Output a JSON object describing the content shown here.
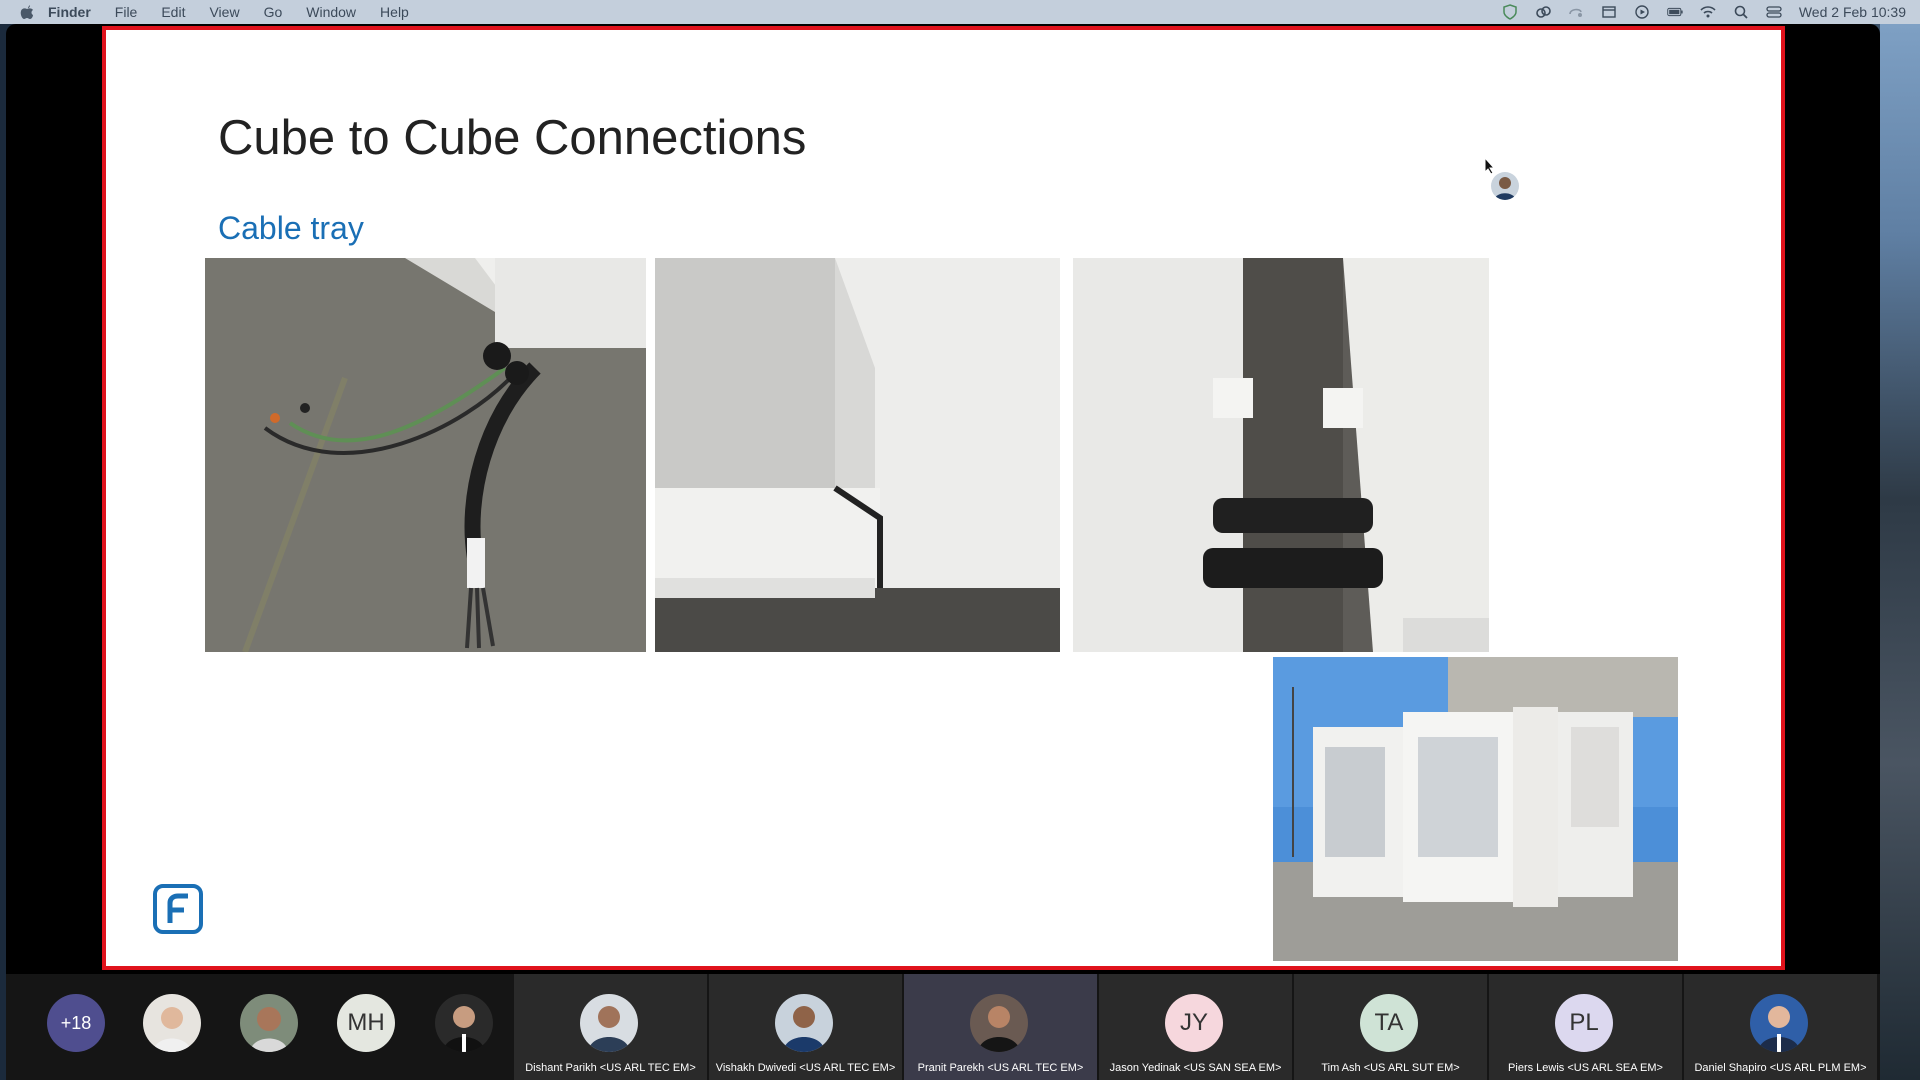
{
  "menubar": {
    "app": "Finder",
    "items": [
      "File",
      "Edit",
      "View",
      "Go",
      "Window",
      "Help"
    ],
    "clock": "Wed 2 Feb  10:39"
  },
  "slide": {
    "title": "Cube to Cube Connections",
    "subtitle": "Cable tray"
  },
  "participants": {
    "more_count": "+18",
    "initials_tile": "MH",
    "tiles": [
      {
        "name": "Dishant Parikh <US ARL TEC EM>",
        "initials": ""
      },
      {
        "name": "Vishakh Dwivedi <US ARL TEC EM>",
        "initials": ""
      },
      {
        "name": "Pranit Parekh  <US ARL TEC EM>",
        "initials": ""
      },
      {
        "name": "Jason Yedinak <US SAN SEA EM>",
        "initials": "JY",
        "color": "#f6d7dd"
      },
      {
        "name": "Tim Ash <US ARL SUT EM>",
        "initials": "TA",
        "color": "#cfe3d6"
      },
      {
        "name": "Piers Lewis <US ARL SEA EM>",
        "initials": "PL",
        "color": "#dcd8ef"
      },
      {
        "name": "Daniel Shapiro <US ARL PLM EM>",
        "initials": ""
      }
    ]
  },
  "colors": {
    "slide_border": "#e0121c",
    "subtitle": "#1a6fb5",
    "more_badge": "#4f4e8f"
  }
}
